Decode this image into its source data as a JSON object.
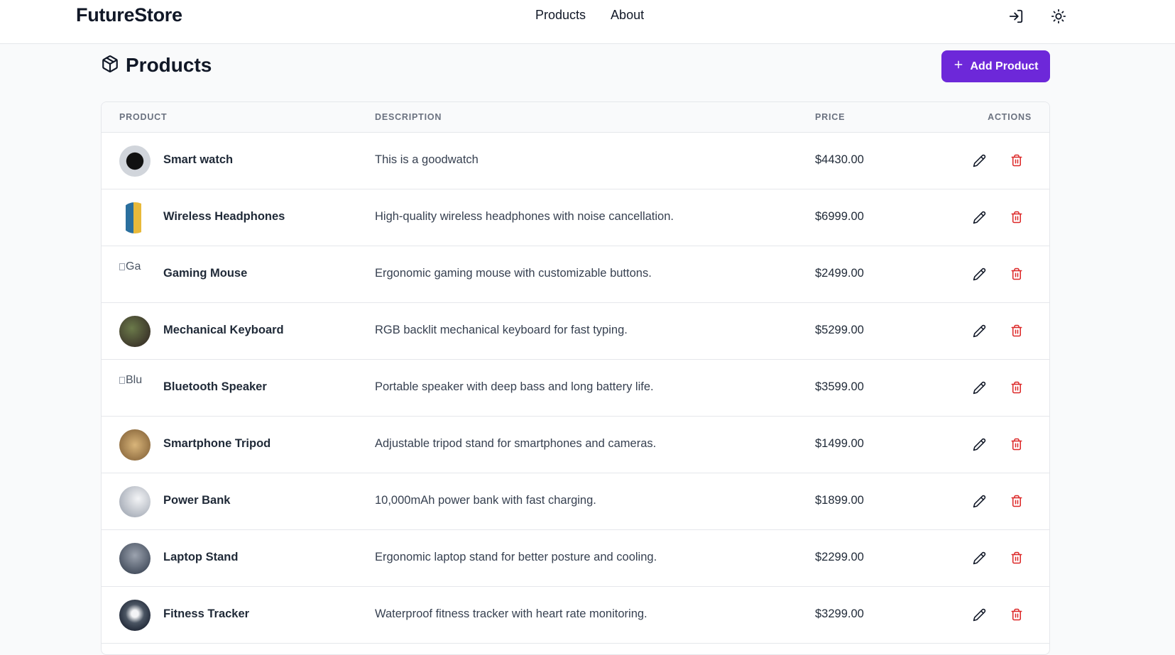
{
  "nav": {
    "brand": "FutureStore",
    "links": [
      "Products",
      "About"
    ],
    "icons": [
      "login-icon",
      "sun-icon"
    ]
  },
  "page": {
    "title": "Products",
    "title_icon": "package-icon",
    "add_button_label": "Add Product",
    "add_button_icon": "plus-icon"
  },
  "colors": {
    "accent": "#6d28d9",
    "delete": "#dc2626",
    "border": "#e5e7eb",
    "header_text": "#6b7280"
  },
  "table": {
    "headers": [
      "PRODUCT",
      "DESCRIPTION",
      "PRICE",
      "ACTIONS"
    ],
    "rows": [
      {
        "name": "Smart watch",
        "description": "This is a goodwatch",
        "price": "$4430.00",
        "image": "photo",
        "alt": ""
      },
      {
        "name": "Wireless Headphones",
        "description": "High-quality wireless headphones with noise cancellation.",
        "price": "$6999.00",
        "image": "photo",
        "alt": ""
      },
      {
        "name": "Gaming Mouse",
        "description": "Ergonomic gaming mouse with customizable buttons.",
        "price": "$2499.00",
        "image": "broken",
        "alt": "Ga"
      },
      {
        "name": "Mechanical Keyboard",
        "description": "RGB backlit mechanical keyboard for fast typing.",
        "price": "$5299.00",
        "image": "photo",
        "alt": ""
      },
      {
        "name": "Bluetooth Speaker",
        "description": "Portable speaker with deep bass and long battery life.",
        "price": "$3599.00",
        "image": "broken",
        "alt": "Blu"
      },
      {
        "name": "Smartphone Tripod",
        "description": "Adjustable tripod stand for smartphones and cameras.",
        "price": "$1499.00",
        "image": "photo",
        "alt": ""
      },
      {
        "name": "Power Bank",
        "description": "10,000mAh power bank with fast charging.",
        "price": "$1899.00",
        "image": "photo",
        "alt": ""
      },
      {
        "name": "Laptop Stand",
        "description": "Ergonomic laptop stand for better posture and cooling.",
        "price": "$2299.00",
        "image": "photo",
        "alt": ""
      },
      {
        "name": "Fitness Tracker",
        "description": "Waterproof fitness tracker with heart rate monitoring.",
        "price": "$3299.00",
        "image": "photo",
        "alt": ""
      }
    ],
    "row_actions": [
      "pencil-icon",
      "trash-icon"
    ]
  }
}
